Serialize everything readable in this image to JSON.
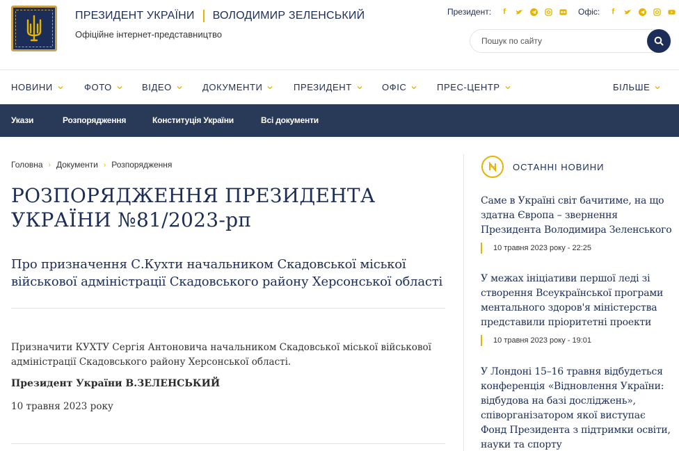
{
  "header": {
    "title_left": "ПРЕЗИДЕНТ УКРАЇНИ",
    "title_right": "ВОЛОДИМИР ЗЕЛЕНСЬКИЙ",
    "subtitle": "Офіційне інтернет-представництво",
    "president_label": "Президент:",
    "office_label": "Офіс:",
    "search_placeholder": "Пошук по сайту",
    "accent_color": "#e4b400",
    "brand_color": "#1c2d57"
  },
  "nav": {
    "items": [
      "НОВИНИ",
      "ФОТО",
      "ВІДЕО",
      "ДОКУМЕНТИ",
      "ПРЕЗИДЕНТ",
      "ОФІС",
      "ПРЕС-ЦЕНТР"
    ],
    "more": "БІЛЬШЕ"
  },
  "subnav": {
    "items": [
      "Укази",
      "Розпорядження",
      "Конституція України",
      "Всі документи"
    ]
  },
  "breadcrumb": [
    "Головна",
    "Документи",
    "Розпорядження"
  ],
  "document": {
    "title": "РОЗПОРЯДЖЕННЯ ПРЕЗИДЕНТА УКРАЇНИ №81/2023-рп",
    "subtitle": "Про призначення С.Кухти начальником Скадовської міської військової адміністрації Скадовського району Херсонської області",
    "body": "Призначити КУХТУ Сергія Антоновича начальником Скадовської міської військової адміністрації Скадовського району Херсонської області.",
    "signature": "Президент України В.ЗЕЛЕНСЬКИЙ",
    "date": "10 травня 2023 року"
  },
  "sidebar": {
    "heading": "ОСТАННІ НОВИНИ",
    "news": [
      {
        "title": "Саме в Україні світ бачитиме, на що здатна Європа – звернення Президента Володимира Зеленського",
        "date": "10 травня 2023 року - 22:25"
      },
      {
        "title": "У межах ініціативи першої леді зі створення Всеукраїнської програми ментального здоров'я міністерства представили пріоритетні проекти",
        "date": "10 травня 2023 року - 19:01"
      },
      {
        "title": "У Лондоні 15–16 травня відбудеться конференція «Відновлення України: відбудова на базі досліджень», співорганізатором якої виступає Фонд Президента з підтримки освіти, науки та спорту",
        "date": ""
      }
    ]
  },
  "icons": {
    "social": [
      "facebook-icon",
      "twitter-icon",
      "telegram-icon",
      "instagram-icon",
      "youtube-icon"
    ]
  }
}
